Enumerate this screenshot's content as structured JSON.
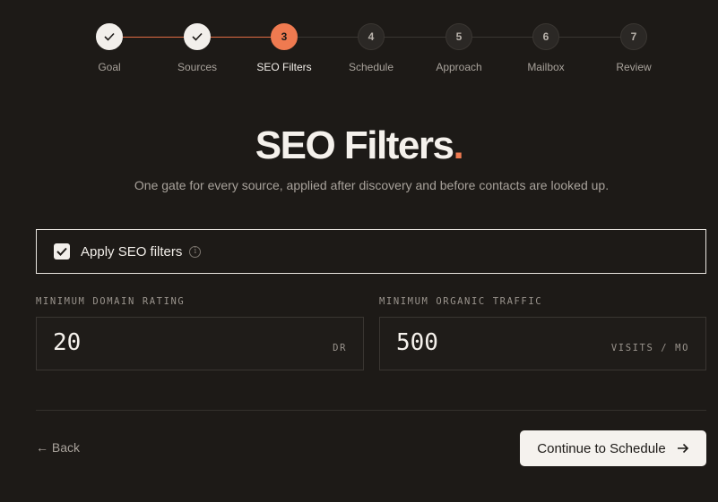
{
  "stepper": {
    "steps": [
      {
        "number": "1",
        "label": "Goal",
        "status": "done"
      },
      {
        "number": "2",
        "label": "Sources",
        "status": "done"
      },
      {
        "number": "3",
        "label": "SEO Filters",
        "status": "active"
      },
      {
        "number": "4",
        "label": "Schedule",
        "status": "pending"
      },
      {
        "number": "5",
        "label": "Approach",
        "status": "pending"
      },
      {
        "number": "6",
        "label": "Mailbox",
        "status": "pending"
      },
      {
        "number": "7",
        "label": "Review",
        "status": "pending"
      }
    ]
  },
  "header": {
    "title": "SEO Filters",
    "title_dot": ".",
    "subtitle": "One gate for every source, applied after discovery and before contacts are looked up."
  },
  "apply": {
    "label": "Apply SEO filters",
    "checked": true,
    "info_icon": "info-icon"
  },
  "fields": {
    "domain_rating": {
      "label": "MINIMUM DOMAIN RATING",
      "value": "20",
      "unit": "DR"
    },
    "organic_traffic": {
      "label": "MINIMUM ORGANIC TRAFFIC",
      "value": "500",
      "unit": "VISITS / MO"
    }
  },
  "footer": {
    "back_label": "← Back",
    "continue_label": "Continue to Schedule"
  },
  "colors": {
    "background": "#1d1a17",
    "accent": "#ef7a50",
    "line_done": "#e36c45"
  }
}
